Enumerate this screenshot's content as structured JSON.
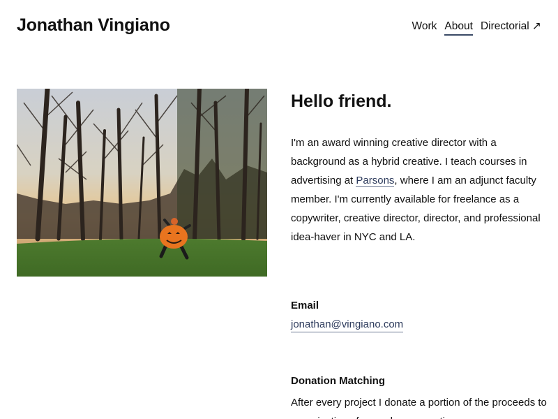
{
  "header": {
    "site_title": "Jonathan Vingiano",
    "nav": [
      {
        "label": "Work",
        "active": false
      },
      {
        "label": "About",
        "active": true
      },
      {
        "label": "Directorial ↗",
        "active": false
      }
    ]
  },
  "main": {
    "greeting": "Hello friend.",
    "bio": {
      "before_link": "I'm an award winning creative director with a background as a hybrid creative. I teach courses in advertising at ",
      "link_text": "Parsons",
      "after_link": ", where I am an adjunct faculty member. I'm currently available for freelance as a copywriter, creative director, director, and professional idea-haver in NYC and LA."
    },
    "email": {
      "heading": "Email",
      "address": "jonathan@vingiano.com"
    },
    "donation": {
      "heading": "Donation Matching",
      "text": "After every project I donate a portion of the proceeds to organizations focused on promoting"
    }
  },
  "colors": {
    "link": "#2d3b5c",
    "active_underline": "#3a4a66",
    "text": "#111111",
    "background": "#ffffff"
  }
}
